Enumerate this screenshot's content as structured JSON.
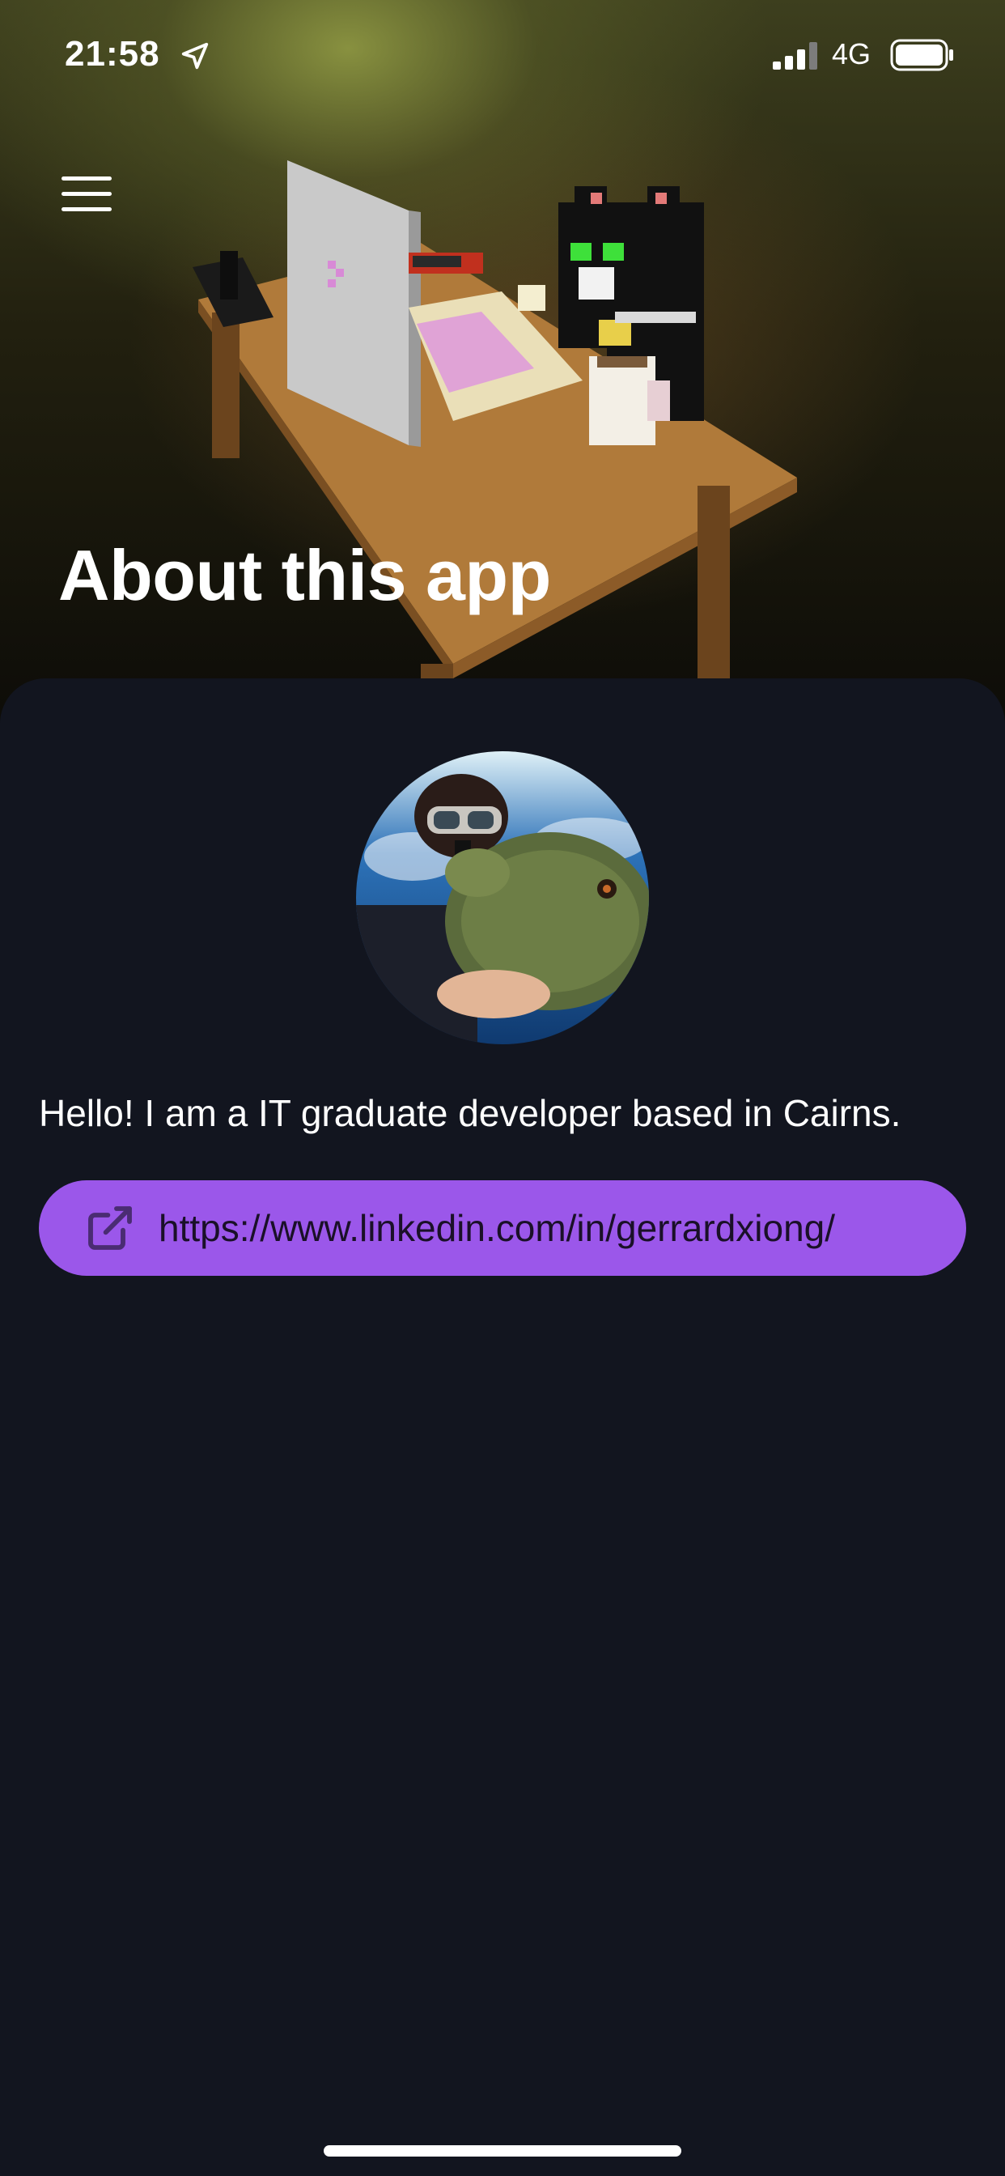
{
  "status_bar": {
    "time": "21:58",
    "network": "4G",
    "location_icon": "location-arrow-icon",
    "signal_icon": "cellular-signal-icon",
    "battery_icon": "battery-full-icon"
  },
  "header": {
    "menu_icon": "hamburger-menu-icon",
    "title": "About this app"
  },
  "profile": {
    "avatar": "avatar-photo",
    "bio": "Hello! I am a IT graduate developer based in Cairns."
  },
  "link": {
    "icon": "external-link-icon",
    "label": "https://www.linkedin.com/in/gerrardxiong/"
  },
  "colors": {
    "background": "#12151f",
    "accent": "#9b57ea",
    "link_text": "#1a1028",
    "text": "#ffffff"
  }
}
